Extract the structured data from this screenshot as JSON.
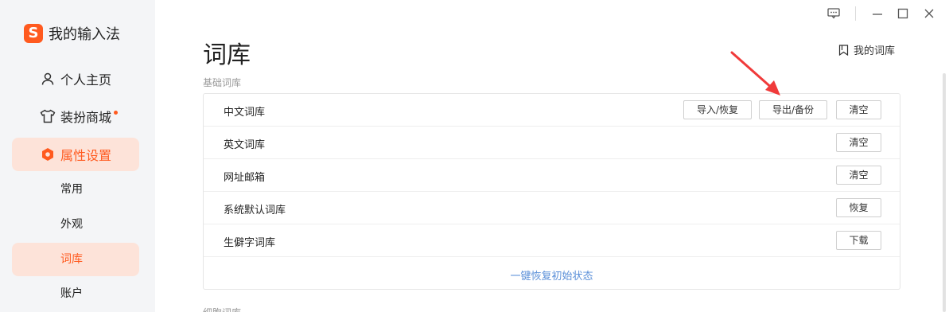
{
  "app": {
    "name": "我的输入法",
    "logo_letter": "S",
    "brand_color": "#ff5a1f"
  },
  "sidebar": {
    "items": [
      {
        "label": "个人主页",
        "icon": "person-icon"
      },
      {
        "label": "装扮商城",
        "icon": "tshirt-icon",
        "badge_dot": true
      },
      {
        "label": "属性设置",
        "icon": "settings-hexagon-icon",
        "active": true
      }
    ],
    "sub_items": [
      {
        "label": "常用"
      },
      {
        "label": "外观"
      },
      {
        "label": "词库",
        "active": true
      },
      {
        "label": "账户"
      }
    ]
  },
  "window_controls": [
    "feedback-icon",
    "minimize-icon",
    "maximize-icon",
    "close-icon"
  ],
  "main": {
    "title": "词库",
    "my_library_link": "我的词库",
    "section_basic": "基础词库",
    "section_next": "细胞词库",
    "rows": [
      {
        "label": "中文词库",
        "buttons": [
          "导入/恢复",
          "导出/备份",
          "清空"
        ]
      },
      {
        "label": "英文词库",
        "buttons": [
          "清空"
        ]
      },
      {
        "label": "网址邮箱",
        "buttons": [
          "清空"
        ]
      },
      {
        "label": "系统默认词库",
        "buttons": [
          "恢复"
        ]
      },
      {
        "label": "生僻字词库",
        "buttons": [
          "下载"
        ]
      }
    ],
    "reset_link": "一键恢复初始状态"
  },
  "annotation": {
    "arrow_color": "#f03a3a"
  }
}
